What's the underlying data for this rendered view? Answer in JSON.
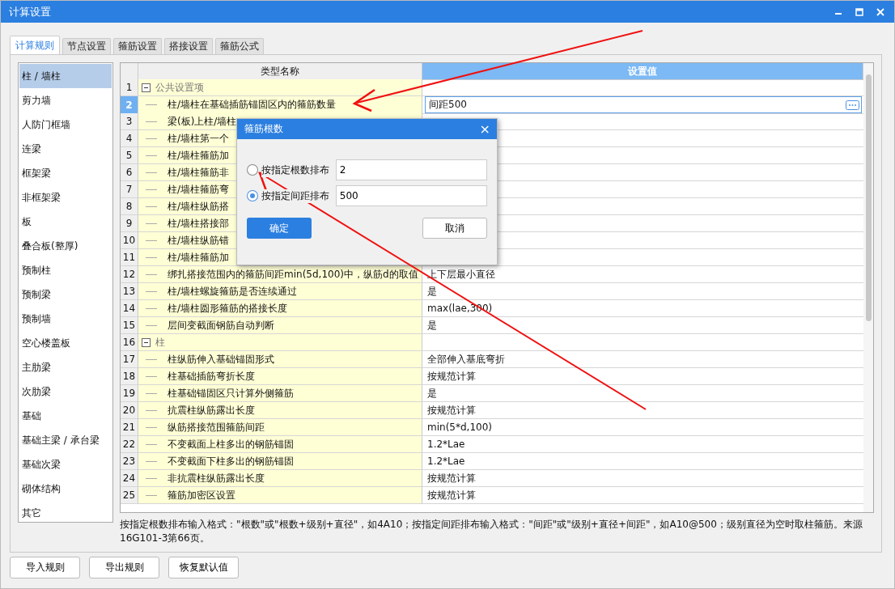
{
  "window": {
    "title": "计算设置"
  },
  "tabs": [
    {
      "label": "计算规则",
      "selected": true
    },
    {
      "label": "节点设置",
      "selected": false
    },
    {
      "label": "箍筋设置",
      "selected": false
    },
    {
      "label": "搭接设置",
      "selected": false
    },
    {
      "label": "箍筋公式",
      "selected": false
    }
  ],
  "sidebar": {
    "items": [
      {
        "label": "柱 / 墙柱",
        "selected": true
      },
      {
        "label": "剪力墙",
        "selected": false
      },
      {
        "label": "人防门框墙",
        "selected": false
      },
      {
        "label": "连梁",
        "selected": false
      },
      {
        "label": "框架梁",
        "selected": false
      },
      {
        "label": "非框架梁",
        "selected": false
      },
      {
        "label": "板",
        "selected": false
      },
      {
        "label": "叠合板(整厚)",
        "selected": false
      },
      {
        "label": "预制柱",
        "selected": false
      },
      {
        "label": "预制梁",
        "selected": false
      },
      {
        "label": "预制墙",
        "selected": false
      },
      {
        "label": "空心楼盖板",
        "selected": false
      },
      {
        "label": "主肋梁",
        "selected": false
      },
      {
        "label": "次肋梁",
        "selected": false
      },
      {
        "label": "基础",
        "selected": false
      },
      {
        "label": "基础主梁 / 承台梁",
        "selected": false
      },
      {
        "label": "基础次梁",
        "selected": false
      },
      {
        "label": "砌体结构",
        "selected": false
      },
      {
        "label": "其它",
        "selected": false
      }
    ]
  },
  "table": {
    "columns": [
      "类型名称",
      "设置值"
    ],
    "rows": [
      {
        "no": "1",
        "name": "公共设置项",
        "expanded": true,
        "selected": false,
        "children": [
          {
            "no": "2",
            "name": "柱/墙柱在基础插筋锚固区内的箍筋数量",
            "value": "间距500",
            "selected": true
          },
          {
            "no": "3",
            "name": "梁(板)上柱/墙柱",
            "selected": false
          },
          {
            "no": "4",
            "name": "柱/墙柱第一个",
            "selected": false
          },
          {
            "no": "5",
            "name": "柱/墙柱箍筋加",
            "selected": false
          },
          {
            "no": "6",
            "name": "柱/墙柱箍筋非",
            "selected": false
          },
          {
            "no": "7",
            "name": "柱/墙柱箍筋弯",
            "selected": false
          },
          {
            "no": "8",
            "name": "柱/墙柱纵筋搭",
            "selected": false
          },
          {
            "no": "9",
            "name": "柱/墙柱搭接部",
            "selected": false
          },
          {
            "no": "10",
            "name": "柱/墙柱纵筋错",
            "selected": false
          },
          {
            "no": "11",
            "name": "柱/墙柱箍筋加",
            "selected": false
          },
          {
            "no": "12",
            "name": "绑扎搭接范围内的箍筋间距min(5d,100)中，纵筋d的取值",
            "value": "上下层最小直径",
            "selected": false
          },
          {
            "no": "13",
            "name": "柱/墙柱螺旋箍筋是否连续通过",
            "value": "是",
            "selected": false
          },
          {
            "no": "14",
            "name": "柱/墙柱圆形箍筋的搭接长度",
            "value": "max(lae,300)",
            "selected": false
          },
          {
            "no": "15",
            "name": "层间变截面钢筋自动判断",
            "value": "是",
            "selected": false
          }
        ]
      },
      {
        "no": "16",
        "name": "柱",
        "expanded": true,
        "selected": false,
        "children": [
          {
            "no": "17",
            "name": "柱纵筋伸入基础锚固形式",
            "value": "全部伸入基底弯折",
            "selected": false
          },
          {
            "no": "18",
            "name": "柱基础插筋弯折长度",
            "value": "按规范计算",
            "selected": false
          },
          {
            "no": "19",
            "name": "柱基础锚固区只计算外侧箍筋",
            "value": "是",
            "selected": false
          },
          {
            "no": "20",
            "name": "抗震柱纵筋露出长度",
            "value": "按规范计算",
            "selected": false
          },
          {
            "no": "21",
            "name": "纵筋搭接范围箍筋间距",
            "value": "min(5*d,100)",
            "selected": false
          },
          {
            "no": "22",
            "name": "不变截面上柱多出的钢筋锚固",
            "value": "1.2*Lae",
            "selected": false
          },
          {
            "no": "23",
            "name": "不变截面下柱多出的钢筋锚固",
            "value": "1.2*Lae",
            "selected": false
          },
          {
            "no": "24",
            "name": "非抗震柱纵筋露出长度",
            "value": "按规范计算",
            "selected": false
          },
          {
            "no": "25",
            "name": "箍筋加密区设置",
            "value": "按规范计算",
            "selected": false
          }
        ]
      }
    ]
  },
  "note": "按指定根数排布输入格式：\"根数\"或\"根数+级别+直径\"，如4A10；按指定间距排布输入格式：\"间距\"或\"级别+直径+间距\"，如A10@500；级别直径为空时取柱箍筋。来源16G101-3第66页。",
  "buttons": [
    "导入规则",
    "导出规则",
    "恢复默认值"
  ],
  "dialog": {
    "title": "箍筋根数",
    "close": "×",
    "options": [
      {
        "label": "按指定根数排布",
        "value": "2",
        "selected": false
      },
      {
        "label": "按指定间距排布",
        "value": "500",
        "selected": true
      }
    ],
    "ok": "确定",
    "cancel": "取消"
  }
}
